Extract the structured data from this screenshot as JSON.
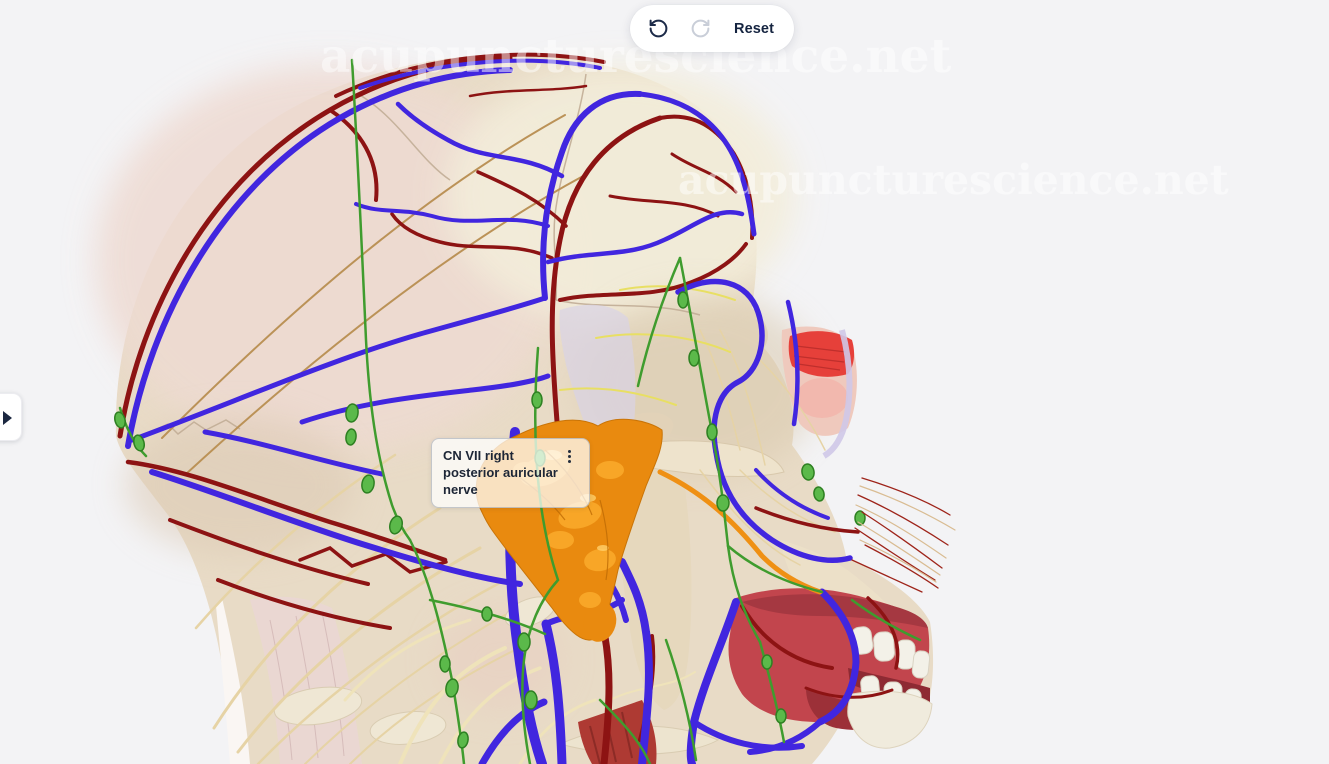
{
  "toolbar": {
    "undo_icon": "undo-icon",
    "redo_icon": "redo-icon",
    "reset_label": "Reset"
  },
  "panel_toggle": {
    "icon": "expand-panel-arrow-icon"
  },
  "selection_tooltip": {
    "text": "CN VII right posterior auricular nerve",
    "menu_icon": "kebab-menu-icon"
  },
  "watermark": {
    "text": "acupuncturescience.net"
  },
  "scene": {
    "description_colors": {
      "background": "#f3f3f5",
      "bone": "#e8dbc6",
      "artery_red": "#8d1313",
      "vein_blue": "#4126df",
      "nerve_cream": "#e6d3a5",
      "lymph_green": "#3f9c2e",
      "selected_gland_orange": "#e98a0f",
      "muscle_red": "#c2454d",
      "toolbar_text": "#152440"
    }
  }
}
